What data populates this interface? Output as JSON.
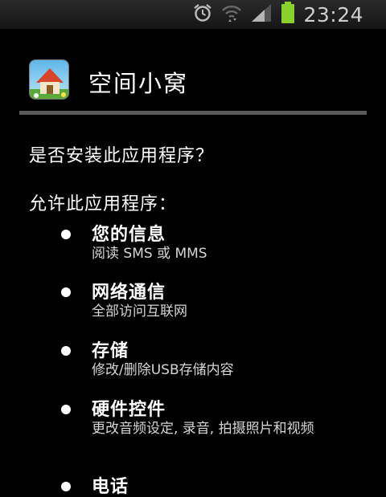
{
  "status_bar": {
    "time": "23:24",
    "icons": [
      "alarm-icon",
      "wifi-icon",
      "signal-icon",
      "battery-icon"
    ],
    "battery_color": "#8bd12b"
  },
  "dialog": {
    "app_name": "空间小窝",
    "question": "是否安装此应用程序？",
    "allow_label": "允许此应用程序：",
    "permissions": [
      {
        "title": "您的信息",
        "desc": "阅读 SMS 或 MMS"
      },
      {
        "title": "网络通信",
        "desc": "全部访问互联网"
      },
      {
        "title": "存储",
        "desc": "修改/删除USB存储内容"
      },
      {
        "title": "硬件控件",
        "desc": "更改音频设定, 录音, 拍摄照片和视频"
      },
      {
        "title": "电话",
        "desc": ""
      }
    ]
  }
}
